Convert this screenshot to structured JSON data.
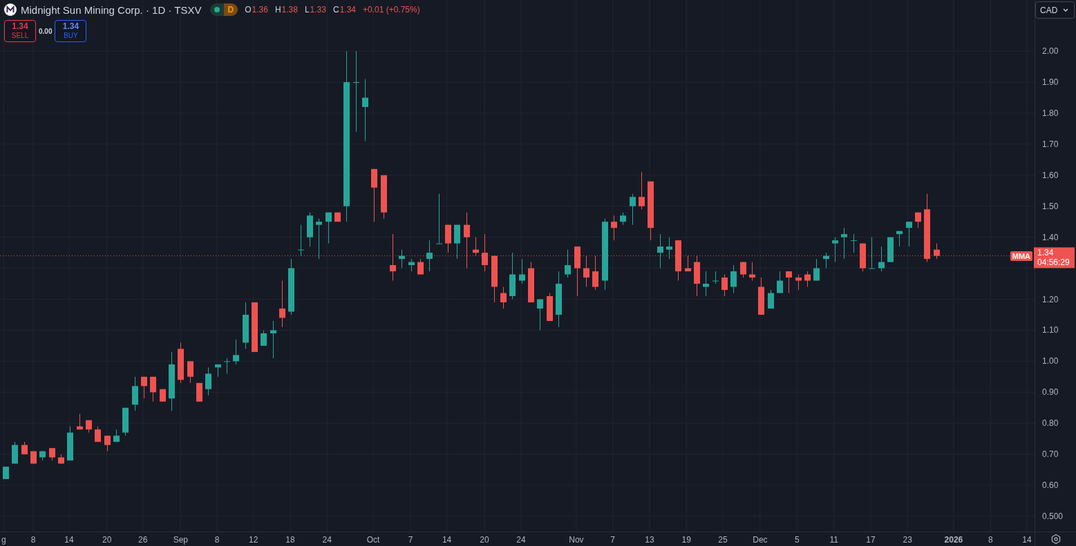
{
  "header": {
    "title": "Midnight Sun Mining Corp. · 1D · TSXV",
    "badge": "D",
    "ohlc": [
      {
        "label": "O",
        "value": "1.36"
      },
      {
        "label": "H",
        "value": "1.38"
      },
      {
        "label": "L",
        "value": "1.33"
      },
      {
        "label": "C",
        "value": "1.34"
      }
    ],
    "change": "+0.01 (+0.75%)"
  },
  "trade": {
    "sell": {
      "price": "1.34",
      "label": "SELL"
    },
    "spread": "0.00",
    "buy": {
      "price": "1.34",
      "label": "BUY"
    }
  },
  "currency": "CAD",
  "price_line": {
    "symbol": "MMA",
    "price": "1.34",
    "countdown": "04:56:29"
  },
  "price_axis": [
    "2.00",
    "1.90",
    "1.80",
    "1.70",
    "1.60",
    "1.50",
    "1.40",
    "1.20",
    "1.10",
    "1.00",
    "0.90",
    "0.80",
    "0.70",
    "0.60",
    "0.500"
  ],
  "time_axis": [
    {
      "label": "g",
      "kind": "day"
    },
    {
      "label": "8",
      "kind": "day"
    },
    {
      "label": "14",
      "kind": "day"
    },
    {
      "label": "20",
      "kind": "day"
    },
    {
      "label": "26",
      "kind": "day"
    },
    {
      "label": "Sep",
      "kind": "month"
    },
    {
      "label": "8",
      "kind": "day"
    },
    {
      "label": "12",
      "kind": "day"
    },
    {
      "label": "18",
      "kind": "day"
    },
    {
      "label": "24",
      "kind": "day"
    },
    {
      "label": "Oct",
      "kind": "month"
    },
    {
      "label": "7",
      "kind": "day"
    },
    {
      "label": "14",
      "kind": "day"
    },
    {
      "label": "20",
      "kind": "day"
    },
    {
      "label": "24",
      "kind": "day"
    },
    {
      "label": "Nov",
      "kind": "month"
    },
    {
      "label": "7",
      "kind": "day"
    },
    {
      "label": "13",
      "kind": "day"
    },
    {
      "label": "19",
      "kind": "day"
    },
    {
      "label": "25",
      "kind": "day"
    },
    {
      "label": "Dec",
      "kind": "month"
    },
    {
      "label": "5",
      "kind": "day"
    },
    {
      "label": "11",
      "kind": "day"
    },
    {
      "label": "17",
      "kind": "day"
    },
    {
      "label": "23",
      "kind": "day"
    },
    {
      "label": "2026",
      "kind": "year"
    },
    {
      "label": "8",
      "kind": "day"
    },
    {
      "label": "14",
      "kind": "day"
    }
  ]
}
